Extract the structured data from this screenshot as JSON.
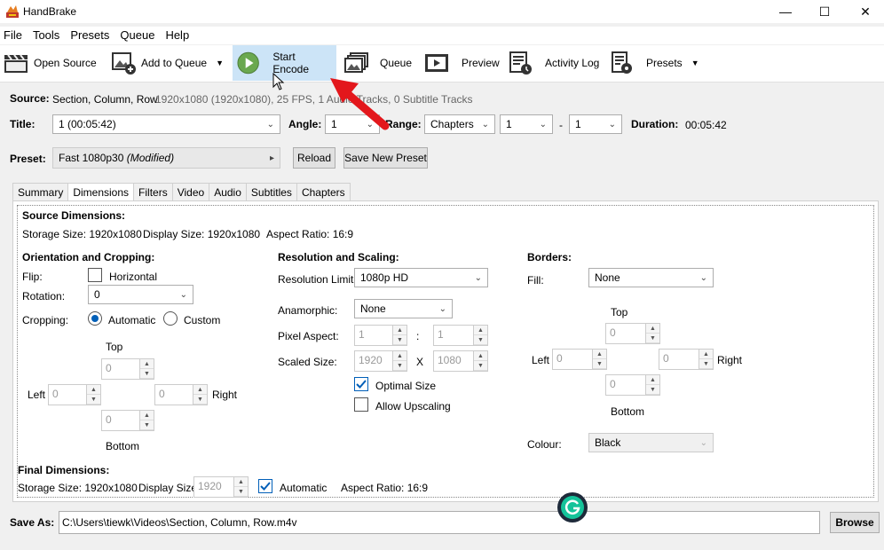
{
  "window": {
    "title": "HandBrake",
    "minimize": "—",
    "maximize": "☐",
    "close": "✕"
  },
  "menu": [
    "File",
    "Tools",
    "Presets",
    "Queue",
    "Help"
  ],
  "toolbar": {
    "open_source": "Open Source",
    "add_to_queue": "Add to Queue",
    "start_encode": "Start Encode",
    "queue": "Queue",
    "preview": "Preview",
    "activity_log": "Activity Log",
    "presets": "Presets",
    "dropdown_arrow": "▼"
  },
  "source": {
    "label": "Source:",
    "name": "Section, Column, Row",
    "info": "1920x1080 (1920x1080), 25 FPS, 1 Audio Tracks, 0 Subtitle Tracks"
  },
  "title_row": {
    "title_label": "Title:",
    "title_value": "1 (00:05:42)",
    "angle_label": "Angle:",
    "angle_value": "1",
    "range_label": "Range:",
    "range_value": "Chapters",
    "range_start": "1",
    "range_dash": "-",
    "range_end": "1",
    "duration_label": "Duration:",
    "duration_value": "00:05:42"
  },
  "preset_row": {
    "label": "Preset:",
    "value": "Fast 1080p30",
    "modified": "(Modified)",
    "reload": "Reload",
    "save_new": "Save New Preset"
  },
  "tabs": [
    "Summary",
    "Dimensions",
    "Filters",
    "Video",
    "Audio",
    "Subtitles",
    "Chapters"
  ],
  "active_tab": "Dimensions",
  "dimensions": {
    "source_heading": "Source Dimensions:",
    "storage_size_label": "Storage Size: 1920x1080",
    "display_size_label": "Display Size: 1920x1080",
    "aspect_ratio_label": "Aspect Ratio: 16:9",
    "orientation_heading": "Orientation and Cropping:",
    "flip_label": "Flip:",
    "flip_horizontal": "Horizontal",
    "rotation_label": "Rotation:",
    "rotation_value": "0",
    "cropping_label": "Cropping:",
    "crop_automatic": "Automatic",
    "crop_custom": "Custom",
    "crop_top": "Top",
    "crop_left": "Left",
    "crop_right": "Right",
    "crop_bottom": "Bottom",
    "crop_top_val": "0",
    "crop_left_val": "0",
    "crop_right_val": "0",
    "crop_bottom_val": "0",
    "resolution_heading": "Resolution and Scaling:",
    "res_limit_label": "Resolution Limit:",
    "res_limit_value": "1080p HD",
    "anamorphic_label": "Anamorphic:",
    "anamorphic_value": "None",
    "pixel_aspect_label": "Pixel Aspect:",
    "pixel_aspect_w": "1",
    "pixel_aspect_sep": ":",
    "pixel_aspect_h": "1",
    "scaled_size_label": "Scaled Size:",
    "scaled_w": "1920",
    "scaled_sep": "X",
    "scaled_h": "1080",
    "optimal_size": "Optimal Size",
    "allow_upscaling": "Allow Upscaling",
    "borders_heading": "Borders:",
    "fill_label": "Fill:",
    "fill_value": "None",
    "border_top": "Top",
    "border_left": "Left",
    "border_right": "Right",
    "border_bottom": "Bottom",
    "border_top_val": "0",
    "border_left_val": "0",
    "border_right_val": "0",
    "border_bottom_val": "0",
    "colour_label": "Colour:",
    "colour_value": "Black",
    "final_heading": "Final Dimensions:",
    "final_storage": "Storage Size: 1920x1080",
    "final_display_label": "Display Size:",
    "final_display_value": "1920",
    "final_automatic": "Automatic",
    "final_aspect": "Aspect Ratio: 16:9"
  },
  "save_as": {
    "label": "Save As:",
    "path": "C:\\Users\\tiewk\\Videos\\Section, Column, Row.m4v",
    "browse": "Browse"
  },
  "colors": {
    "accent": "#005fb8",
    "highlight": "#cce4f7",
    "arrow": "#e3171c",
    "grammarly": "#15c39a"
  },
  "icons": [
    "handbrake-icon",
    "clapper-icon",
    "add-image-icon",
    "play-icon",
    "queue-icon",
    "preview-icon",
    "activity-log-icon",
    "presets-icon",
    "cursor-icon",
    "grammarly-icon"
  ]
}
